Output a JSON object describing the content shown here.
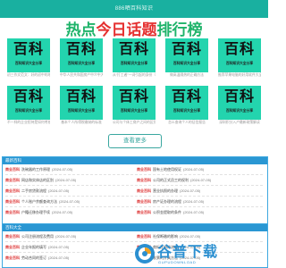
{
  "header": {
    "site_name": "886晒百科知识"
  },
  "hero": {
    "part1": "热点",
    "part2": "今日话题",
    "part3": "排行榜"
  },
  "cards": [
    {
      "big": "百科",
      "small": "百科知识大全分享",
      "caption": "初三作文范文：好的初中的地方名..."
    },
    {
      "big": "百科",
      "small": "百科知识大全分享",
      "caption": "中华人民共和国房产中介中大局出..."
    },
    {
      "big": "百科",
      "small": "百科知识大全分享",
      "caption": "从“打工者”一词引起的身份（认..."
    },
    {
      "big": "百科",
      "small": "百科知识大全分享",
      "caption": "做高温隔热的正确方法"
    },
    {
      "big": "百科",
      "small": "百科知识大全分享",
      "caption": "推荐苹果电脑的好用软件大全"
    },
    {
      "big": "百科",
      "small": "百科知识大全分享",
      "caption": "不一样的企业招待是如何考核的"
    },
    {
      "big": "百科",
      "small": "百科知识大全分享",
      "caption": "基本个人所得税缴纳的标准"
    },
    {
      "big": "百科",
      "small": "百科知识大全分享",
      "caption": "公司与个体工商户之间的区别"
    },
    {
      "big": "百科",
      "small": "百科知识大全分享",
      "caption": "怎么查询个人的征信报告"
    },
    {
      "big": "百科",
      "small": "百科知识大全分享",
      "caption": "深圳积分入户最新政策解读"
    }
  ],
  "more_button": "查看更多",
  "section1": {
    "title": "最新百科",
    "rows": [
      {
        "tag": "商业百科",
        "title": "洗碗器的工作原理",
        "date": "(2024-07-05)"
      },
      {
        "tag": "商业百科",
        "title": "国有土地使用权证",
        "date": "(2024-07-05)"
      },
      {
        "tag": "商业百科",
        "title": "网店和实体店的区别",
        "date": "(2024-07-05)"
      },
      {
        "tag": "商业百科",
        "title": "公司的正式员工的权利",
        "date": "(2024-07-05)"
      },
      {
        "tag": "商业百科",
        "title": "二手房贷款流程",
        "date": "(2024-07-05)"
      },
      {
        "tag": "商业百科",
        "title": "营业执照的办理",
        "date": "(2024-07-05)"
      },
      {
        "tag": "商业百科",
        "title": "个人账户余额查询方法",
        "date": "(2024-07-05)"
      },
      {
        "tag": "商业百科",
        "title": "房产证办理的流程",
        "date": "(2024-07-05)"
      },
      {
        "tag": "商业百科",
        "title": "户籍迁移办理手续",
        "date": "(2024-07-05)"
      },
      {
        "tag": "商业百科",
        "title": "公积金提取的条件",
        "date": "(2024-07-05)"
      }
    ]
  },
  "section2": {
    "title": "百科大全",
    "rows": [
      {
        "tag": "商业百科",
        "title": "公司注册流程及费用",
        "date": "(2024-07-05)"
      },
      {
        "tag": "商业百科",
        "title": "社保断缴的影响",
        "date": "(2024-07-05)"
      },
      {
        "tag": "商业百科",
        "title": "企业年报的填写",
        "date": "(2024-07-05)"
      },
      {
        "tag": "商业百科",
        "title": "商标注册的流程",
        "date": "(2024-07-05)"
      },
      {
        "tag": "商业百科",
        "title": "劳动合同的签订",
        "date": "(2024-07-05)"
      },
      {
        "tag": "商业百科",
        "title": "发票的开具方法",
        "date": "(2024-07-05)"
      }
    ]
  },
  "logo": {
    "zh": "谷普下载",
    "en": "GUPUDOWNLOAD"
  },
  "colors": {
    "accent": "#19b0a0",
    "card": "#23d4ae",
    "section": "#2a97d3",
    "tag": "#dd3333"
  }
}
